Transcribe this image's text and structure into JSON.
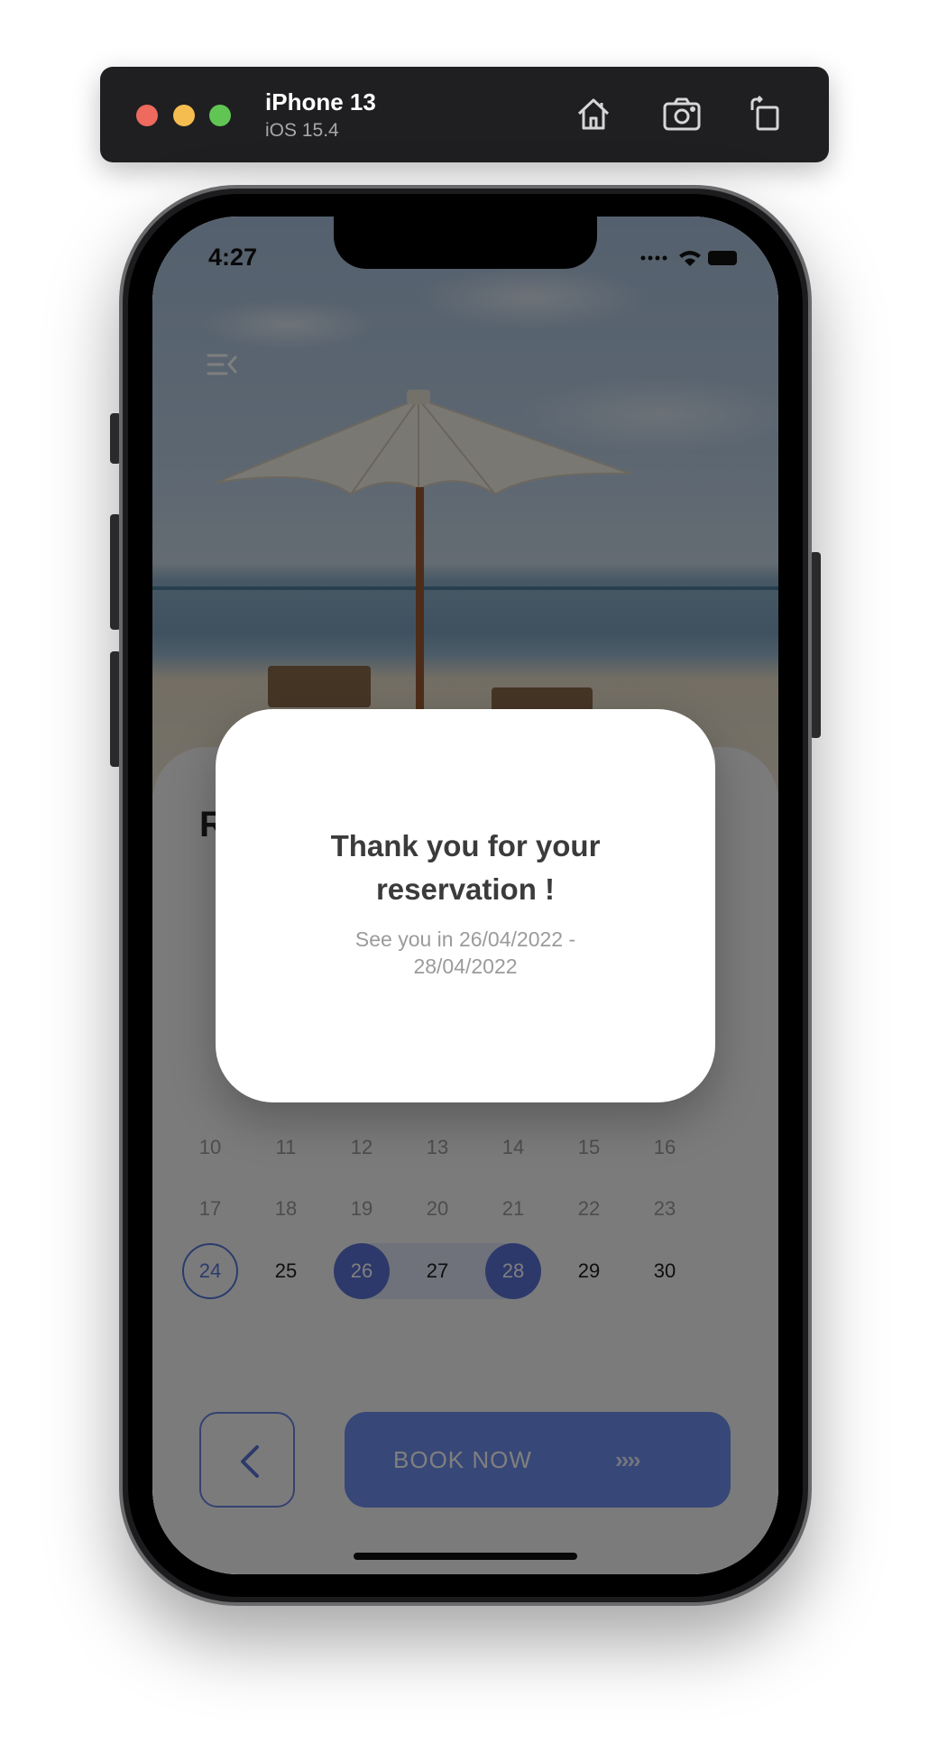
{
  "simulator": {
    "device_name": "iPhone 13",
    "os_version": "iOS 15.4",
    "tools": [
      "home-icon",
      "screenshot-icon",
      "rotate-icon"
    ]
  },
  "status_bar": {
    "time": "4:27"
  },
  "screen": {
    "title_partial": "R",
    "calendar": {
      "rows": [
        [
          "10",
          "11",
          "12",
          "13",
          "14",
          "15",
          "16"
        ],
        [
          "17",
          "18",
          "19",
          "20",
          "21",
          "22",
          "23"
        ],
        [
          "24",
          "25",
          "26",
          "27",
          "28",
          "29",
          "30"
        ]
      ],
      "today": "24",
      "range_start": "26",
      "range_end": "28"
    },
    "book_button": {
      "label": "BOOK NOW",
      "arrows": "››››"
    }
  },
  "modal": {
    "title": "Thank you for your reservation !",
    "subtitle": "See you in 26/04/2022 - 28/04/2022"
  },
  "colors": {
    "accent": "#5a73d4",
    "book_button": "#6f8fee",
    "range_band": "#dfe4f6"
  }
}
